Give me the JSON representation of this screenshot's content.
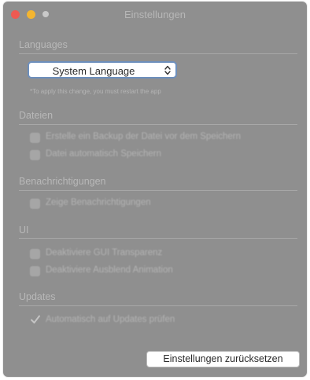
{
  "window": {
    "title": "Einstellungen",
    "colors": {
      "close": "#ee5a52",
      "minimize": "#f3b530",
      "maximize": "#c9c9c9",
      "background": "#8f8f8f",
      "accent": "#6d8fbd"
    }
  },
  "languages": {
    "heading": "Languages",
    "select_value": "System Language",
    "hint": "*To apply this change, you must restart the app"
  },
  "dateien": {
    "heading": "Dateien",
    "options": [
      {
        "label": "Erstelle ein Backup der Datei vor dem Speichern",
        "checked": false
      },
      {
        "label": "Datei automatisch Speichern",
        "checked": false
      }
    ]
  },
  "benachrichtigungen": {
    "heading": "Benachrichtigungen",
    "options": [
      {
        "label": "Zeige Benachrichtigungen",
        "checked": false
      }
    ]
  },
  "ui": {
    "heading": "UI",
    "options": [
      {
        "label": "Deaktiviere GUI Transparenz",
        "checked": false
      },
      {
        "label": "Deaktiviere Ausblend Animation",
        "checked": false
      }
    ]
  },
  "updates": {
    "heading": "Updates",
    "options": [
      {
        "label": "Automatisch auf Updates prüfen",
        "checked": true
      }
    ]
  },
  "footer": {
    "reset_label": "Einstellungen zurücksetzen"
  }
}
